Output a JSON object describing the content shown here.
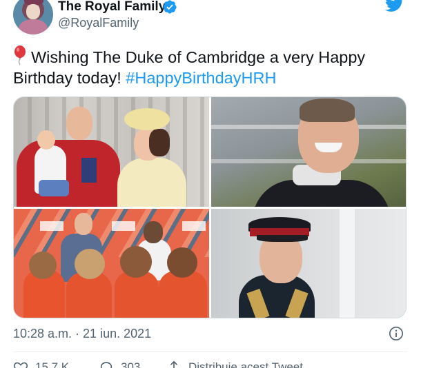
{
  "account": {
    "display_name": "The Royal Family",
    "handle": "@RoyalFamily",
    "verified": true
  },
  "tweet": {
    "text": "Wishing The Duke of Cambridge a very Happy Birthday today! ",
    "hashtag": "#HappyBirthdayHRH",
    "emoji_icon": "red-balloon-icon",
    "timestamp": "10:28 a.m. · 21 iun. 2021"
  },
  "media": {
    "photos": [
      {
        "name": "family-balcony-photo"
      },
      {
        "name": "racing-suit-photo"
      },
      {
        "name": "youth-tennis-photo"
      },
      {
        "name": "military-uniform-photo"
      }
    ]
  },
  "actions": {
    "likes": "15,7 K",
    "replies": "303",
    "share_label": "Distribuie acest Tweet"
  },
  "colors": {
    "accent": "#1d9bf0",
    "secondary_text": "#536471",
    "border": "#cfd9de"
  }
}
